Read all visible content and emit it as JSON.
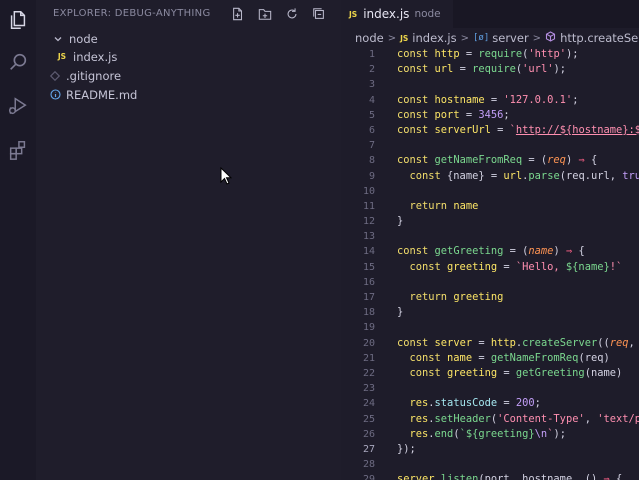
{
  "activity": {
    "icons": [
      "explorer-icon",
      "search-icon",
      "run-debug-icon",
      "extensions-icon"
    ]
  },
  "sidebar": {
    "title": "EXPLORER: DEBUG-ANYTHING",
    "actions": [
      "new-file-icon",
      "new-folder-icon",
      "refresh-icon",
      "collapse-all-icon"
    ],
    "tree": [
      {
        "label": "node",
        "kind": "folder-open"
      },
      {
        "label": "index.js",
        "kind": "js-file",
        "badge": "JS"
      },
      {
        "label": ".gitignore",
        "kind": "gitignore-file"
      },
      {
        "label": "README.md",
        "kind": "info-file"
      }
    ]
  },
  "editor": {
    "tab": {
      "badge": "JS",
      "name": "index.js",
      "description": "node"
    },
    "breadcrumb": {
      "folder": "node",
      "file_badge": "JS",
      "file": "index.js",
      "symbol_icon": "[ø]",
      "symbol": "server",
      "method_icon": "method-icon",
      "method": "http.createServer() c"
    },
    "line_numbers": [
      "1",
      "2",
      "3",
      "4",
      "5",
      "6",
      "7",
      "8",
      "9",
      "10",
      "11",
      "12",
      "13",
      "14",
      "15",
      "16",
      "17",
      "18",
      "19",
      "20",
      "21",
      "22",
      "23",
      "24",
      "25",
      "26",
      "27",
      "28",
      "29"
    ],
    "active_line": "27",
    "lines": [
      [
        {
          "t": "const ",
          "c": "kw"
        },
        {
          "t": "http",
          "c": "var"
        },
        {
          "t": " = ",
          "c": ""
        },
        {
          "t": "require",
          "c": "fn"
        },
        {
          "t": "(",
          "c": ""
        },
        {
          "t": "'http'",
          "c": "str"
        },
        {
          "t": ");",
          "c": ""
        }
      ],
      [
        {
          "t": "const ",
          "c": "kw"
        },
        {
          "t": "url",
          "c": "var"
        },
        {
          "t": " = ",
          "c": ""
        },
        {
          "t": "require",
          "c": "fn"
        },
        {
          "t": "(",
          "c": ""
        },
        {
          "t": "'url'",
          "c": "str"
        },
        {
          "t": ");",
          "c": ""
        }
      ],
      [],
      [
        {
          "t": "const ",
          "c": "kw"
        },
        {
          "t": "hostname",
          "c": "var"
        },
        {
          "t": " = ",
          "c": ""
        },
        {
          "t": "'127.0.0.1'",
          "c": "str"
        },
        {
          "t": ";",
          "c": ""
        }
      ],
      [
        {
          "t": "const ",
          "c": "kw"
        },
        {
          "t": "port",
          "c": "var"
        },
        {
          "t": " = ",
          "c": ""
        },
        {
          "t": "3456",
          "c": "num"
        },
        {
          "t": ";",
          "c": ""
        }
      ],
      [
        {
          "t": "const ",
          "c": "kw"
        },
        {
          "t": "serverUrl",
          "c": "var"
        },
        {
          "t": " = ",
          "c": ""
        },
        {
          "t": "`",
          "c": "str"
        },
        {
          "t": "http://${hostname}:${",
          "c": "link"
        }
      ],
      [],
      [
        {
          "t": "const ",
          "c": "kw"
        },
        {
          "t": "getNameFromReq",
          "c": "fn"
        },
        {
          "t": " = (",
          "c": ""
        },
        {
          "t": "req",
          "c": "param"
        },
        {
          "t": ") ",
          "c": ""
        },
        {
          "t": "⇒",
          "c": "op"
        },
        {
          "t": " {",
          "c": ""
        }
      ],
      [
        {
          "t": "  const ",
          "c": "kw"
        },
        {
          "t": "{name}",
          "c": ""
        },
        {
          "t": " = ",
          "c": ""
        },
        {
          "t": "url",
          "c": "var"
        },
        {
          "t": ".",
          "c": ""
        },
        {
          "t": "parse",
          "c": "fn"
        },
        {
          "t": "(req.url, ",
          "c": ""
        },
        {
          "t": "true",
          "c": "num"
        }
      ],
      [],
      [
        {
          "t": "  return ",
          "c": "kw"
        },
        {
          "t": "name",
          "c": "var"
        }
      ],
      [
        {
          "t": "}",
          "c": ""
        }
      ],
      [],
      [
        {
          "t": "const ",
          "c": "kw"
        },
        {
          "t": "getGreeting",
          "c": "fn"
        },
        {
          "t": " = (",
          "c": ""
        },
        {
          "t": "name",
          "c": "param"
        },
        {
          "t": ") ",
          "c": ""
        },
        {
          "t": "⇒",
          "c": "op"
        },
        {
          "t": " {",
          "c": ""
        }
      ],
      [
        {
          "t": "  const ",
          "c": "kw"
        },
        {
          "t": "greeting",
          "c": "var"
        },
        {
          "t": " = ",
          "c": ""
        },
        {
          "t": "`Hello, ",
          "c": "str"
        },
        {
          "t": "${name}",
          "c": "tpl"
        },
        {
          "t": "!`",
          "c": "str"
        }
      ],
      [],
      [
        {
          "t": "  return ",
          "c": "kw"
        },
        {
          "t": "greeting",
          "c": "var"
        }
      ],
      [
        {
          "t": "}",
          "c": ""
        }
      ],
      [],
      [
        {
          "t": "const ",
          "c": "kw"
        },
        {
          "t": "server",
          "c": "var"
        },
        {
          "t": " = ",
          "c": ""
        },
        {
          "t": "http",
          "c": "var"
        },
        {
          "t": ".",
          "c": ""
        },
        {
          "t": "createServer",
          "c": "fn"
        },
        {
          "t": "((",
          "c": ""
        },
        {
          "t": "req",
          "c": "param"
        },
        {
          "t": ", ",
          "c": ""
        },
        {
          "t": "r",
          "c": "param"
        }
      ],
      [
        {
          "t": "  const ",
          "c": "kw"
        },
        {
          "t": "name",
          "c": "var"
        },
        {
          "t": " = ",
          "c": ""
        },
        {
          "t": "getNameFromReq",
          "c": "fn"
        },
        {
          "t": "(req)",
          "c": ""
        }
      ],
      [
        {
          "t": "  const ",
          "c": "kw"
        },
        {
          "t": "greeting",
          "c": "var"
        },
        {
          "t": " = ",
          "c": ""
        },
        {
          "t": "getGreeting",
          "c": "fn"
        },
        {
          "t": "(name)",
          "c": ""
        }
      ],
      [],
      [
        {
          "t": "  res",
          "c": "var"
        },
        {
          "t": ".",
          "c": ""
        },
        {
          "t": "statusCode",
          "c": "prop"
        },
        {
          "t": " = ",
          "c": ""
        },
        {
          "t": "200",
          "c": "num"
        },
        {
          "t": ";",
          "c": ""
        }
      ],
      [
        {
          "t": "  res",
          "c": "var"
        },
        {
          "t": ".",
          "c": ""
        },
        {
          "t": "setHeader",
          "c": "fn"
        },
        {
          "t": "(",
          "c": ""
        },
        {
          "t": "'Content-Type'",
          "c": "str"
        },
        {
          "t": ", ",
          "c": ""
        },
        {
          "t": "'text/pl",
          "c": "str"
        }
      ],
      [
        {
          "t": "  res",
          "c": "var"
        },
        {
          "t": ".",
          "c": ""
        },
        {
          "t": "end",
          "c": "fn"
        },
        {
          "t": "(",
          "c": ""
        },
        {
          "t": "`${greeting}",
          "c": "tpl"
        },
        {
          "t": "\\n",
          "c": "esc"
        },
        {
          "t": "`",
          "c": "str"
        },
        {
          "t": ");",
          "c": ""
        }
      ],
      [
        {
          "t": "});",
          "c": ""
        }
      ],
      [],
      [
        {
          "t": "server",
          "c": "var"
        },
        {
          "t": ".",
          "c": ""
        },
        {
          "t": "listen",
          "c": "fn"
        },
        {
          "t": "(port, hostname, () ",
          "c": ""
        },
        {
          "t": "⇒",
          "c": "op"
        },
        {
          "t": " {",
          "c": ""
        }
      ]
    ]
  },
  "colors": {
    "accent": "#f3de6c",
    "background": "#1e1c2a",
    "sidebar": "#1f1d2b",
    "activity_bar": "#1b1927"
  }
}
